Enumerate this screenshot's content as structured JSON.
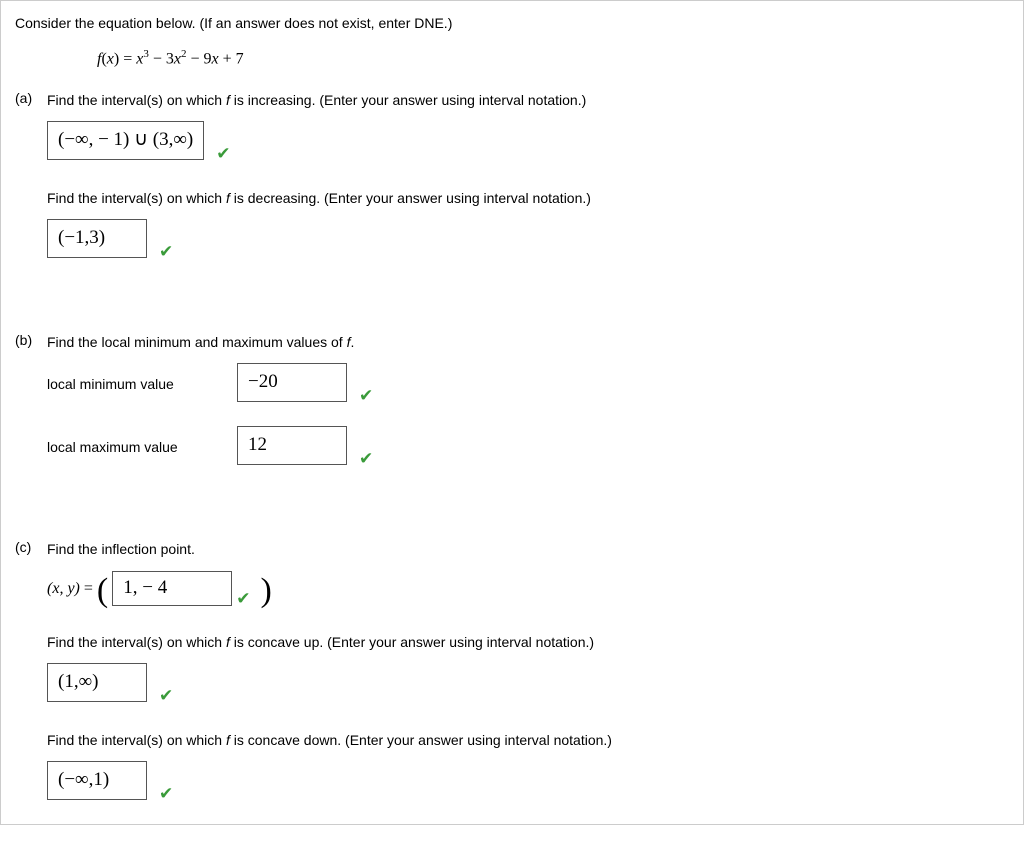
{
  "intro": "Consider the equation below. (If an answer does not exist, enter DNE.)",
  "equation_html": "f(x) = x³ − 3x² − 9x + 7",
  "parts": {
    "a": {
      "label": "(a)",
      "q1": "Find the interval(s) on which f is increasing. (Enter your answer using interval notation.)",
      "a1": "(−∞, − 1) ∪ (3,∞)",
      "q2": "Find the interval(s) on which f is decreasing. (Enter your answer using interval notation.)",
      "a2": "(−1,3)"
    },
    "b": {
      "label": "(b)",
      "q": "Find the local minimum and maximum values of f.",
      "min_label": "local minimum value",
      "min_val": "−20",
      "max_label": "local maximum value",
      "max_val": "12"
    },
    "c": {
      "label": "(c)",
      "q_infl": "Find the inflection point.",
      "xy_label": "(x, y) = ",
      "infl_val": "1, − 4",
      "q_up": "Find the interval(s) on which f is concave up. (Enter your answer using interval notation.)",
      "a_up": "(1,∞)",
      "q_down": "Find the interval(s) on which f is concave down. (Enter your answer using interval notation.)",
      "a_down": "(−∞,1)"
    }
  }
}
